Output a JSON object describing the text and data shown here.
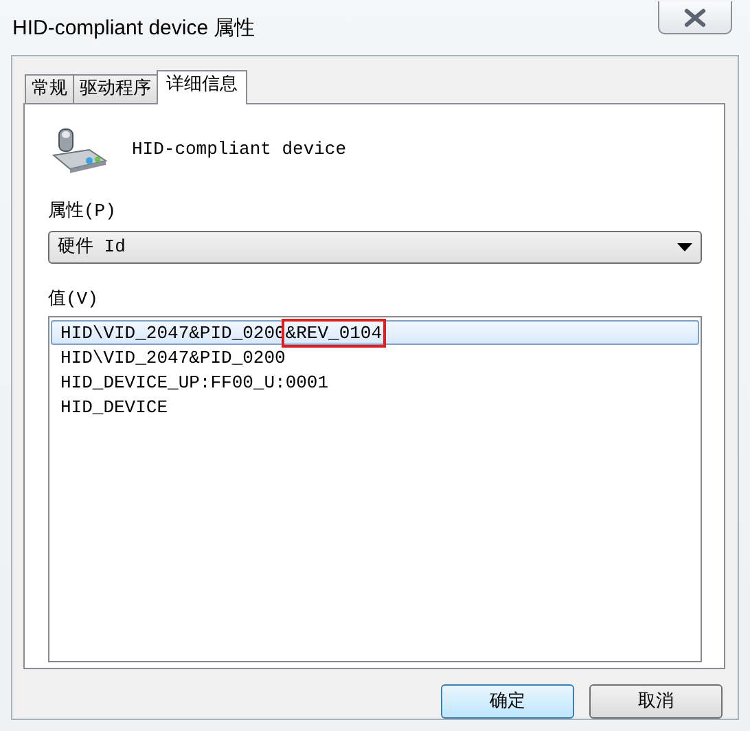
{
  "window": {
    "title": "HID-compliant device 属性"
  },
  "tabs": [
    {
      "label": "常规",
      "selected": false
    },
    {
      "label": "驱动程序",
      "selected": false
    },
    {
      "label": "详细信息",
      "selected": true
    }
  ],
  "device": {
    "name": "HID-compliant device"
  },
  "property": {
    "label": "属性(P)",
    "value": "硬件 Id"
  },
  "values": {
    "label": "值(V)",
    "items": [
      {
        "text": "HID\\VID_2047&PID_0200",
        "annotated": "&REV_0104",
        "selected": true
      },
      {
        "text": "HID\\VID_2047&PID_0200",
        "selected": false
      },
      {
        "text": "HID_DEVICE_UP:FF00_U:0001",
        "selected": false
      },
      {
        "text": "HID_DEVICE",
        "selected": false
      }
    ]
  },
  "buttons": [
    {
      "label": "确定",
      "kind": "default"
    },
    {
      "label": "取消",
      "kind": "normal"
    }
  ]
}
